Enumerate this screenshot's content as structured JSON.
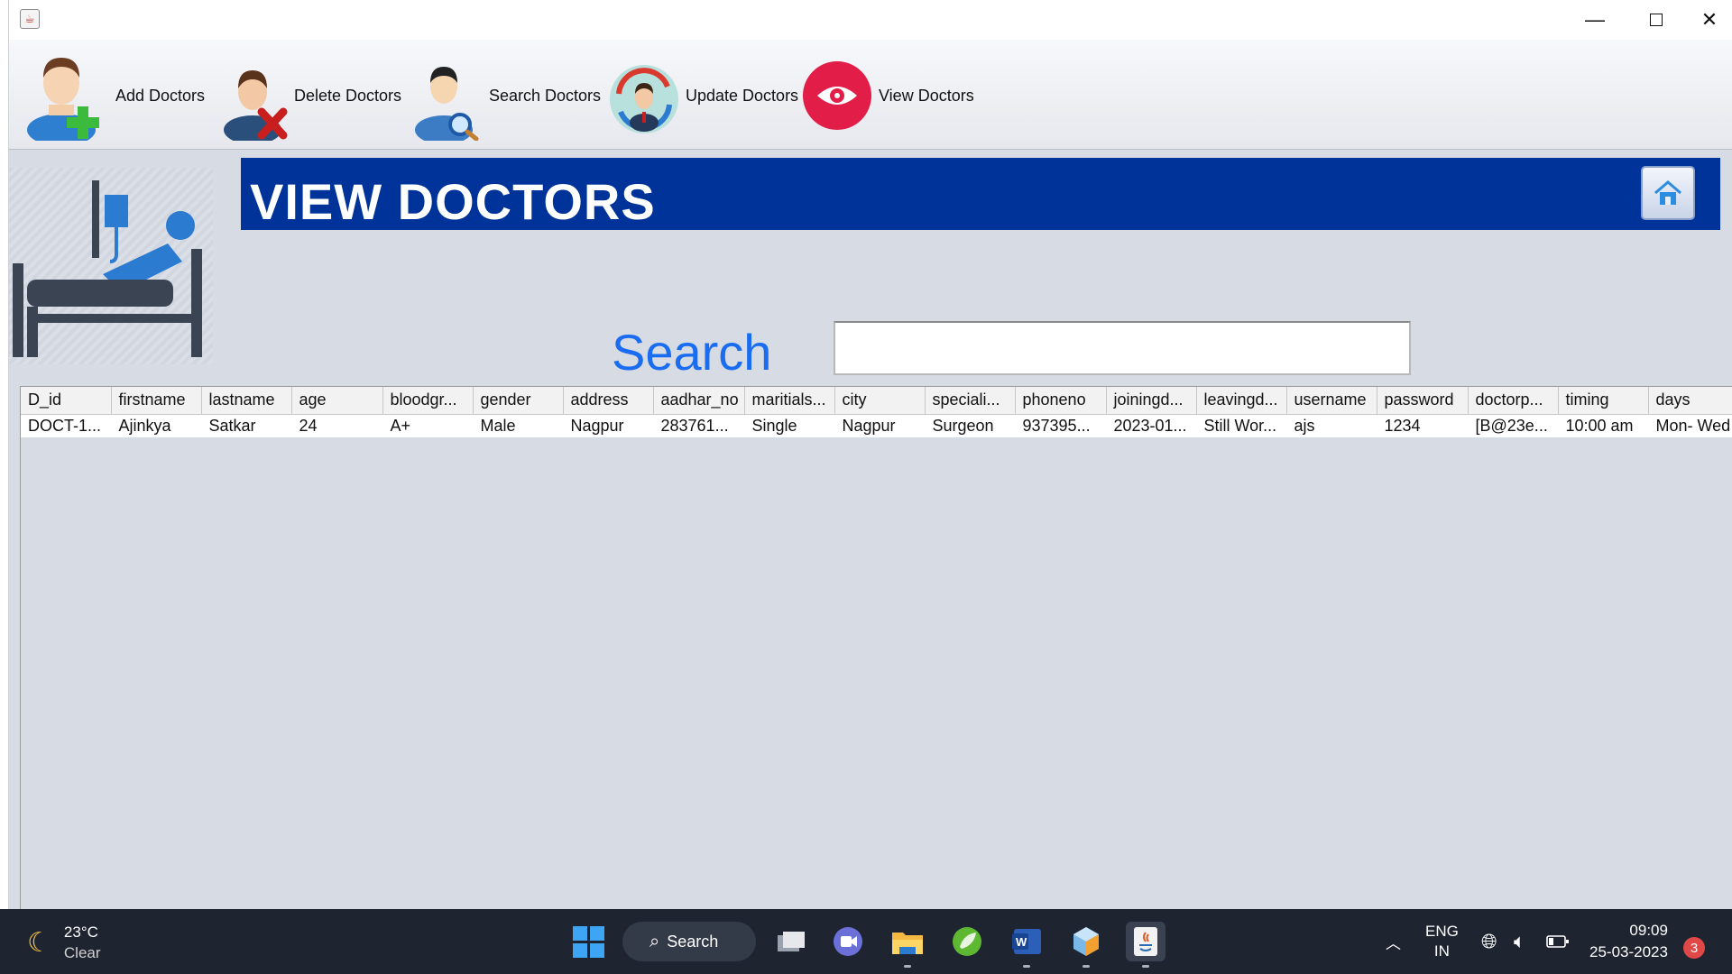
{
  "window": {
    "minimize_glyph": "—",
    "close_glyph": "✕"
  },
  "toolbar": {
    "items": [
      {
        "label": "Add Doctors",
        "icon": "add-doctor-icon"
      },
      {
        "label": "Delete Doctors",
        "icon": "delete-doctor-icon"
      },
      {
        "label": "Search Doctors",
        "icon": "search-doctor-icon"
      },
      {
        "label": "Update Doctors",
        "icon": "update-doctor-icon"
      },
      {
        "label": "View Doctors",
        "icon": "view-doctor-icon"
      }
    ]
  },
  "banner": {
    "title": "VIEW DOCTORS",
    "home_icon": "home-icon"
  },
  "search": {
    "label": "Search",
    "value": "",
    "placeholder": ""
  },
  "table": {
    "columns": [
      "D_id",
      "firstname",
      "lastname",
      "age",
      "bloodgr...",
      "gender",
      "address",
      "aadhar_no",
      "maritials...",
      "city",
      "speciali...",
      "phoneno",
      "joiningd...",
      "leavingd...",
      "username",
      "password",
      "doctorp...",
      "timing",
      "days"
    ],
    "rows": [
      [
        "DOCT-1...",
        "Ajinkya",
        "Satkar",
        "24",
        "A+",
        "Male",
        "Nagpur",
        "283761...",
        "Single",
        "Nagpur",
        "Surgeon",
        "937395...",
        "2023-01...",
        "Still Wor...",
        "ajs",
        "1234",
        "[B@23e...",
        "10:00 am",
        "Mon- Wed"
      ]
    ]
  },
  "taskbar": {
    "weather_temp": "23°C",
    "weather_cond": "Clear",
    "search_label": "Search",
    "lang_top": "ENG",
    "lang_bottom": "IN",
    "time": "09:09",
    "date": "25-03-2023",
    "notification_count": "3"
  },
  "colors": {
    "banner": "#003399",
    "search_label": "#1a6df0",
    "window_bg": "#d7dbe4"
  }
}
